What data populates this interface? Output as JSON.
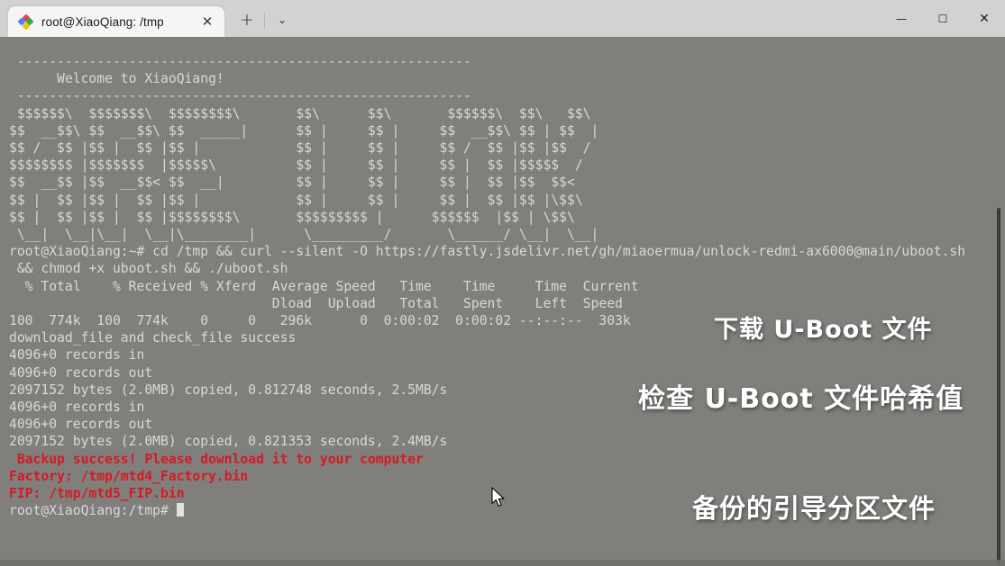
{
  "window": {
    "controls": {
      "minimize": "—",
      "maximize": "☐",
      "close": "✕"
    }
  },
  "tabbar": {
    "tab": {
      "title": "root@XiaoQiang: /tmp",
      "icon": "xiaoqiang-diamond-icon",
      "close_label": "✕"
    },
    "new_tab_label": "+",
    "dropdown_label": "⌄"
  },
  "terminal": {
    "background_color": "#807f7c",
    "text_color": "#d8d8d6",
    "alert_color": "#d61a23",
    "lines": [
      {
        "text": "",
        "style": "normal"
      },
      {
        "text": " ---------------------------------------------------------",
        "style": "normal"
      },
      {
        "text": "      Welcome to XiaoQiang!",
        "style": "normal"
      },
      {
        "text": " ---------------------------------------------------------",
        "style": "normal"
      },
      {
        "text": " $$$$$$\\  $$$$$$$\\  $$$$$$$$\\       $$\\      $$\\       $$$$$$\\  $$\\   $$\\",
        "style": "normal"
      },
      {
        "text": "$$  __$$\\ $$  __$$\\ $$  _____|      $$ |     $$ |     $$  __$$\\ $$ | $$  |",
        "style": "normal"
      },
      {
        "text": "$$ /  $$ |$$ |  $$ |$$ |            $$ |     $$ |     $$ /  $$ |$$ |$$  /",
        "style": "normal"
      },
      {
        "text": "$$$$$$$$ |$$$$$$$  |$$$$$\\          $$ |     $$ |     $$ |  $$ |$$$$$  /",
        "style": "normal"
      },
      {
        "text": "$$  __$$ |$$  __$$< $$  __|         $$ |     $$ |     $$ |  $$ |$$  $$<",
        "style": "normal"
      },
      {
        "text": "$$ |  $$ |$$ |  $$ |$$ |            $$ |     $$ |     $$ |  $$ |$$ |\\$$\\",
        "style": "normal"
      },
      {
        "text": "$$ |  $$ |$$ |  $$ |$$$$$$$$\\       $$$$$$$$$ |      $$$$$$  |$$ | \\$$\\",
        "style": "normal"
      },
      {
        "text": " \\__|  \\__|\\__|  \\__|\\________|      \\_________/       \\______/ \\__|  \\__|",
        "style": "normal"
      },
      {
        "text": "",
        "style": "normal"
      },
      {
        "text": "",
        "style": "normal"
      },
      {
        "text": "root@XiaoQiang:~# cd /tmp && curl --silent -O https://fastly.jsdelivr.net/gh/miaoermua/unlock-redmi-ax6000@main/uboot.sh",
        "style": "normal"
      },
      {
        "text": " && chmod +x uboot.sh && ./uboot.sh",
        "style": "normal"
      },
      {
        "text": "  % Total    % Received % Xferd  Average Speed   Time    Time     Time  Current",
        "style": "normal"
      },
      {
        "text": "                                 Dload  Upload   Total   Spent    Left  Speed",
        "style": "normal"
      },
      {
        "text": "100  774k  100  774k    0     0   296k      0  0:00:02  0:00:02 --:--:--  303k",
        "style": "normal"
      },
      {
        "text": "download_file and check_file success",
        "style": "normal"
      },
      {
        "text": "4096+0 records in",
        "style": "normal"
      },
      {
        "text": "4096+0 records out",
        "style": "normal"
      },
      {
        "text": "2097152 bytes (2.0MB) copied, 0.812748 seconds, 2.5MB/s",
        "style": "normal"
      },
      {
        "text": "4096+0 records in",
        "style": "normal"
      },
      {
        "text": "4096+0 records out",
        "style": "normal"
      },
      {
        "text": "2097152 bytes (2.0MB) copied, 0.821353 seconds, 2.4MB/s",
        "style": "normal"
      },
      {
        "text": " Backup success! Please download it to your computer",
        "style": "red"
      },
      {
        "text": "Factory: /tmp/mtd4_Factory.bin",
        "style": "red"
      },
      {
        "text": "FIP: /tmp/mtd5_FIP.bin",
        "style": "red"
      }
    ],
    "prompt": "root@XiaoQiang:/tmp# "
  },
  "annotations": [
    {
      "text": "下载 U-Boot 文件"
    },
    {
      "text": "检查 U-Boot 文件哈希值"
    },
    {
      "text": "备份的引导分区文件"
    }
  ]
}
